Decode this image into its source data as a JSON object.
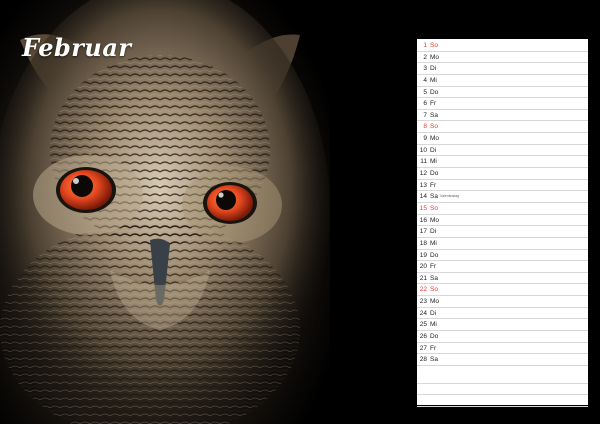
{
  "header": {
    "month": "Februar"
  },
  "photo": {
    "subject": "eagle owl close-up",
    "eye_color": "#e4471f"
  },
  "calendar": {
    "days": [
      {
        "n": "1",
        "d": "So",
        "sunday": true,
        "note": ""
      },
      {
        "n": "2",
        "d": "Mo",
        "sunday": false,
        "note": ""
      },
      {
        "n": "3",
        "d": "Di",
        "sunday": false,
        "note": ""
      },
      {
        "n": "4",
        "d": "Mi",
        "sunday": false,
        "note": ""
      },
      {
        "n": "5",
        "d": "Do",
        "sunday": false,
        "note": ""
      },
      {
        "n": "6",
        "d": "Fr",
        "sunday": false,
        "note": ""
      },
      {
        "n": "7",
        "d": "Sa",
        "sunday": false,
        "note": ""
      },
      {
        "n": "8",
        "d": "So",
        "sunday": true,
        "note": ""
      },
      {
        "n": "9",
        "d": "Mo",
        "sunday": false,
        "note": ""
      },
      {
        "n": "10",
        "d": "Di",
        "sunday": false,
        "note": ""
      },
      {
        "n": "11",
        "d": "Mi",
        "sunday": false,
        "note": ""
      },
      {
        "n": "12",
        "d": "Do",
        "sunday": false,
        "note": ""
      },
      {
        "n": "13",
        "d": "Fr",
        "sunday": false,
        "note": ""
      },
      {
        "n": "14",
        "d": "Sa",
        "sunday": false,
        "note": "Valentinstag"
      },
      {
        "n": "15",
        "d": "So",
        "sunday": true,
        "note": ""
      },
      {
        "n": "16",
        "d": "Mo",
        "sunday": false,
        "note": ""
      },
      {
        "n": "17",
        "d": "Di",
        "sunday": false,
        "note": ""
      },
      {
        "n": "18",
        "d": "Mi",
        "sunday": false,
        "note": ""
      },
      {
        "n": "19",
        "d": "Do",
        "sunday": false,
        "note": ""
      },
      {
        "n": "20",
        "d": "Fr",
        "sunday": false,
        "note": ""
      },
      {
        "n": "21",
        "d": "Sa",
        "sunday": false,
        "note": ""
      },
      {
        "n": "22",
        "d": "So",
        "sunday": true,
        "note": ""
      },
      {
        "n": "23",
        "d": "Mo",
        "sunday": false,
        "note": ""
      },
      {
        "n": "24",
        "d": "Di",
        "sunday": false,
        "note": ""
      },
      {
        "n": "25",
        "d": "Mi",
        "sunday": false,
        "note": ""
      },
      {
        "n": "26",
        "d": "Do",
        "sunday": false,
        "note": ""
      },
      {
        "n": "27",
        "d": "Fr",
        "sunday": false,
        "note": ""
      },
      {
        "n": "28",
        "d": "Sa",
        "sunday": false,
        "note": ""
      }
    ],
    "sunday_color": "#e53a2f",
    "text_color": "#222222"
  }
}
